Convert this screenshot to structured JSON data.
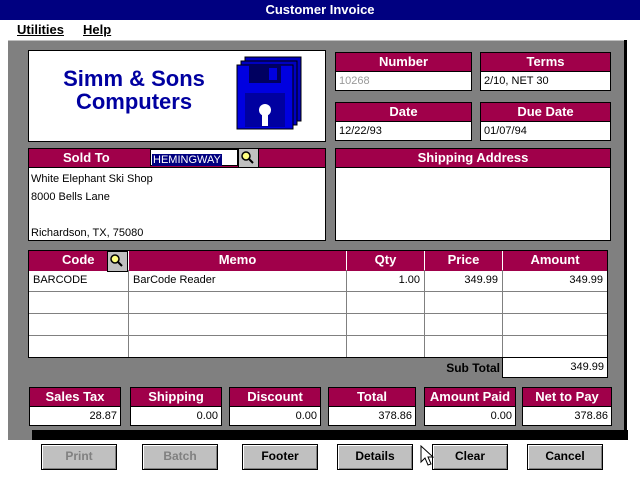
{
  "window": {
    "title": "Customer Invoice"
  },
  "menu": [
    {
      "label": "Utilities"
    },
    {
      "label": "Help"
    }
  ],
  "company": {
    "line1": "Simm & Sons",
    "line2": "Computers"
  },
  "icons": {
    "logo": "floppy-disks-icon",
    "search": "magnifier-icon",
    "cursor": "arrow-cursor-icon"
  },
  "colors": {
    "header": "#a0004a",
    "logo_blue": "#0000a0"
  },
  "invoice": {
    "number_label": "Number",
    "number": "10268",
    "terms_label": "Terms",
    "terms": "2/10, NET 30",
    "date_label": "Date",
    "date": "12/22/93",
    "due_label": "Due Date",
    "due": "01/07/94"
  },
  "sold_to": {
    "label": "Sold To",
    "customer_id": "HEMINGWAY",
    "address": [
      "White Elephant Ski Shop",
      "8000 Bells Lane",
      "",
      "Richardson, TX, 75080"
    ]
  },
  "shipping": {
    "label": "Shipping Address"
  },
  "lines": {
    "headers": {
      "code": "Code",
      "memo": "Memo",
      "qty": "Qty",
      "price": "Price",
      "amount": "Amount"
    },
    "rows": [
      {
        "code": "BARCODE",
        "memo": "BarCode Reader",
        "qty": "1.00",
        "price": "349.99",
        "amount": "349.99"
      },
      {
        "code": "",
        "memo": "",
        "qty": "",
        "price": "",
        "amount": ""
      },
      {
        "code": "",
        "memo": "",
        "qty": "",
        "price": "",
        "amount": ""
      },
      {
        "code": "",
        "memo": "",
        "qty": "",
        "price": "",
        "amount": ""
      }
    ],
    "subtotal_label": "Sub Total",
    "subtotal": "349.99"
  },
  "totals": [
    {
      "label": "Sales Tax",
      "value": "28.87"
    },
    {
      "label": "Shipping",
      "value": "0.00"
    },
    {
      "label": "Discount",
      "value": "0.00"
    },
    {
      "label": "Total",
      "value": "378.86"
    },
    {
      "label": "Amount Paid",
      "value": "0.00"
    },
    {
      "label": "Net to Pay",
      "value": "378.86"
    }
  ],
  "buttons": {
    "print": "Print",
    "batch": "Batch",
    "footer": "Footer",
    "details": "Details",
    "clear": "Clear",
    "cancel": "Cancel"
  }
}
